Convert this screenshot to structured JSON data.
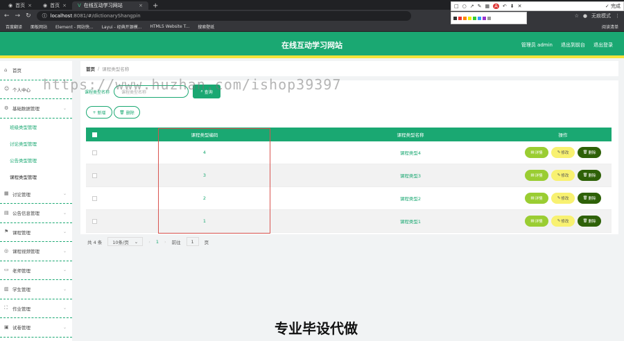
{
  "browser": {
    "tabs": [
      {
        "label": "首页"
      },
      {
        "label": "首页"
      },
      {
        "label": "在线互动学习网站"
      }
    ],
    "url_host": "localhost",
    "url_path": ":8081/#/dictionaryShangpin",
    "profile_label": "无痕模式",
    "bookmarks": [
      "百度翻译",
      "面板网站",
      "Element - 网站快...",
      "Layui - 经典开源模...",
      "HTML5 Website T...",
      "搜索壁纸"
    ],
    "bookmarks_end": "阅读清单"
  },
  "capture_tool": {
    "finish_label": "完成"
  },
  "header": {
    "title": "在线互动学习网站",
    "admin": "管理员 admin",
    "back": "退出到前台",
    "logout": "退出登录"
  },
  "sidebar": {
    "items": [
      {
        "label": "首页",
        "icon": "home-icon"
      },
      {
        "label": "个人中心",
        "icon": "user-icon"
      },
      {
        "label": "基础数据管理",
        "icon": "gear-icon"
      },
      {
        "label": "班级类型管理",
        "sub": true
      },
      {
        "label": "讨论类型管理",
        "sub": true
      },
      {
        "label": "公告类型管理",
        "sub": true
      },
      {
        "label": "课程类型管理",
        "sub": true,
        "active": true
      },
      {
        "label": "讨论管理",
        "icon": "grid-icon"
      },
      {
        "label": "公告信息管理",
        "icon": "doc-icon"
      },
      {
        "label": "课程管理",
        "icon": "flag-icon"
      },
      {
        "label": "课程视频管理",
        "icon": "video-icon"
      },
      {
        "label": "老师管理",
        "icon": "card-icon"
      },
      {
        "label": "学生管理",
        "icon": "building-icon"
      },
      {
        "label": "作业管理",
        "icon": "frame-icon"
      },
      {
        "label": "试卷管理",
        "icon": "paper-icon"
      }
    ]
  },
  "breadcrumb": {
    "home": "首页",
    "sep": "/",
    "current": "课程类型名称"
  },
  "search": {
    "label": "课程类型名称",
    "placeholder": "课程类型名称",
    "button": "查询"
  },
  "ops": {
    "add": "新增",
    "delete": "删除"
  },
  "table": {
    "headers": [
      "课程类型编码",
      "课程类型名称",
      "操作"
    ],
    "rows": [
      {
        "code": "4",
        "name": "课程类型4"
      },
      {
        "code": "3",
        "name": "课程类型3"
      },
      {
        "code": "2",
        "name": "课程类型2"
      },
      {
        "code": "1",
        "name": "课程类型1"
      }
    ],
    "action_detail": "详情",
    "action_edit": "修改",
    "action_delete": "删除"
  },
  "pager": {
    "total": "共 4 条",
    "page_size": "10条/页",
    "current": "1",
    "goto": "前往",
    "goto_value": "1",
    "page_suffix": "页"
  },
  "overlay": {
    "watermark": "https://www.huzhan.com/ishop39397",
    "bottom_text": "专业毕设代做"
  },
  "colors": {
    "brand": "#1aa872",
    "accent": "#f5e33b",
    "detail": "#9acd32",
    "edit": "#f8f171",
    "delete": "#2e6108"
  }
}
